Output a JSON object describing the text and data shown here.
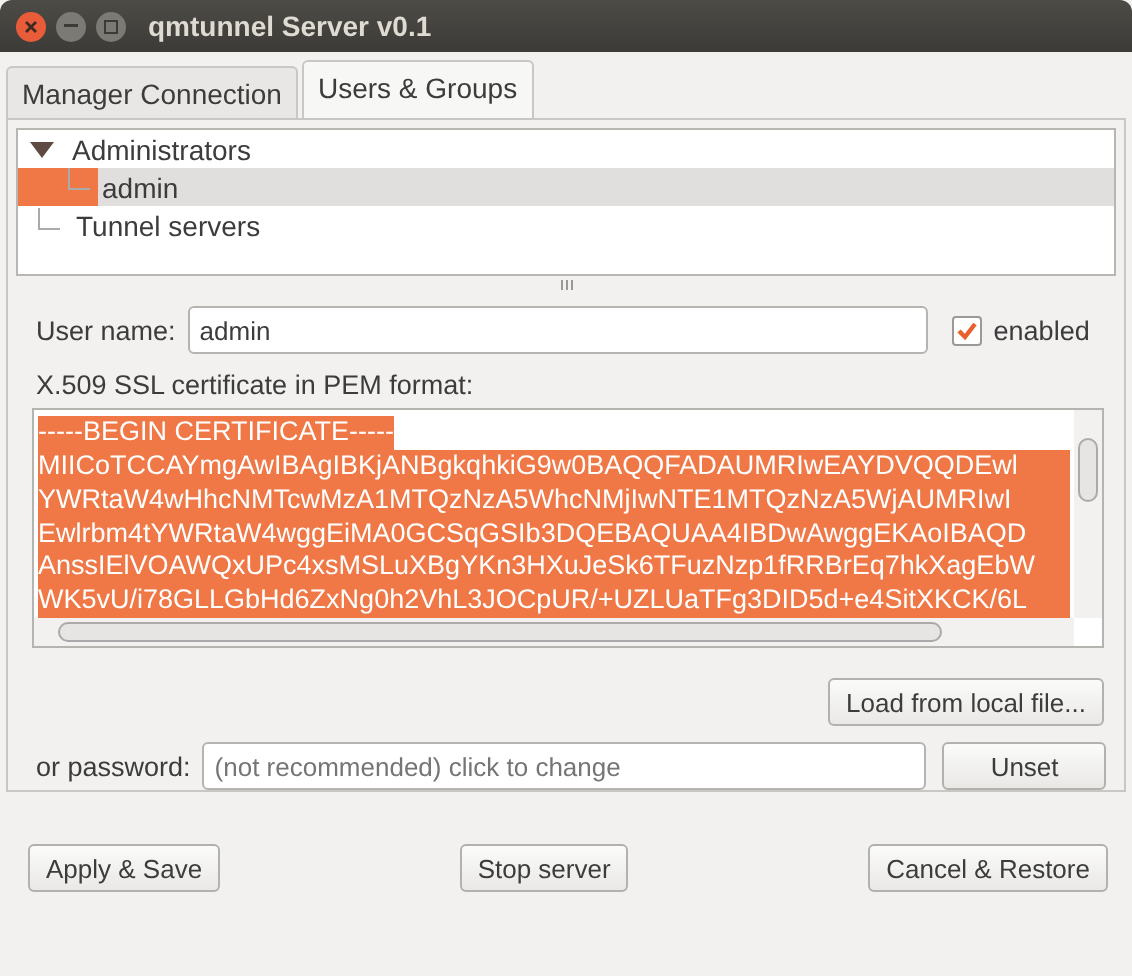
{
  "window": {
    "title": "qmtunnel Server v0.1"
  },
  "tabs": [
    {
      "label": "Manager Connection",
      "selected": false
    },
    {
      "label": "Users & Groups",
      "selected": true
    }
  ],
  "tree": [
    {
      "label": "Administrators",
      "expanded": true,
      "selected": false,
      "children": [
        {
          "label": "admin",
          "selected": true
        }
      ]
    },
    {
      "label": "Tunnel servers",
      "selected": false
    }
  ],
  "user_name": {
    "label": "User name:",
    "value": "admin"
  },
  "enabled": {
    "label": "enabled",
    "checked": true
  },
  "certificate": {
    "label": "X.509 SSL certificate in PEM format:",
    "lines": [
      "-----BEGIN CERTIFICATE-----",
      "MIICoTCCAYmgAwIBAgIBKjANBgkqhkiG9w0BAQQFADAUMRIwEAYDVQQDEwl",
      "YWRtaW4wHhcNMTcwMzA1MTQzNzA5WhcNMjIwNTE1MTQzNzA5WjAUMRIwI",
      "Ewlrbm4tYWRtaW4wggEiMA0GCSqGSIb3DQEBAQUAA4IBDwAwggEKAoIBAQD",
      "AnssIElVOAWQxUPc4xsMSLuXBgYKn3HXuJeSk6TFuzNzp1fRRBrEq7hkXagEbW",
      "WK5vU/i78GLLGbHd6ZxNg0h2VhL3JOCpUR/+UZLUaTFg3DID5d+e4SitXKCK/6L"
    ]
  },
  "load_button": "Load from local file...",
  "password": {
    "label": "or password:",
    "placeholder": "(not recommended) click to change"
  },
  "unset_button": "Unset",
  "buttons": [
    "Apply & Save",
    "Stop server",
    "Cancel & Restore"
  ]
}
